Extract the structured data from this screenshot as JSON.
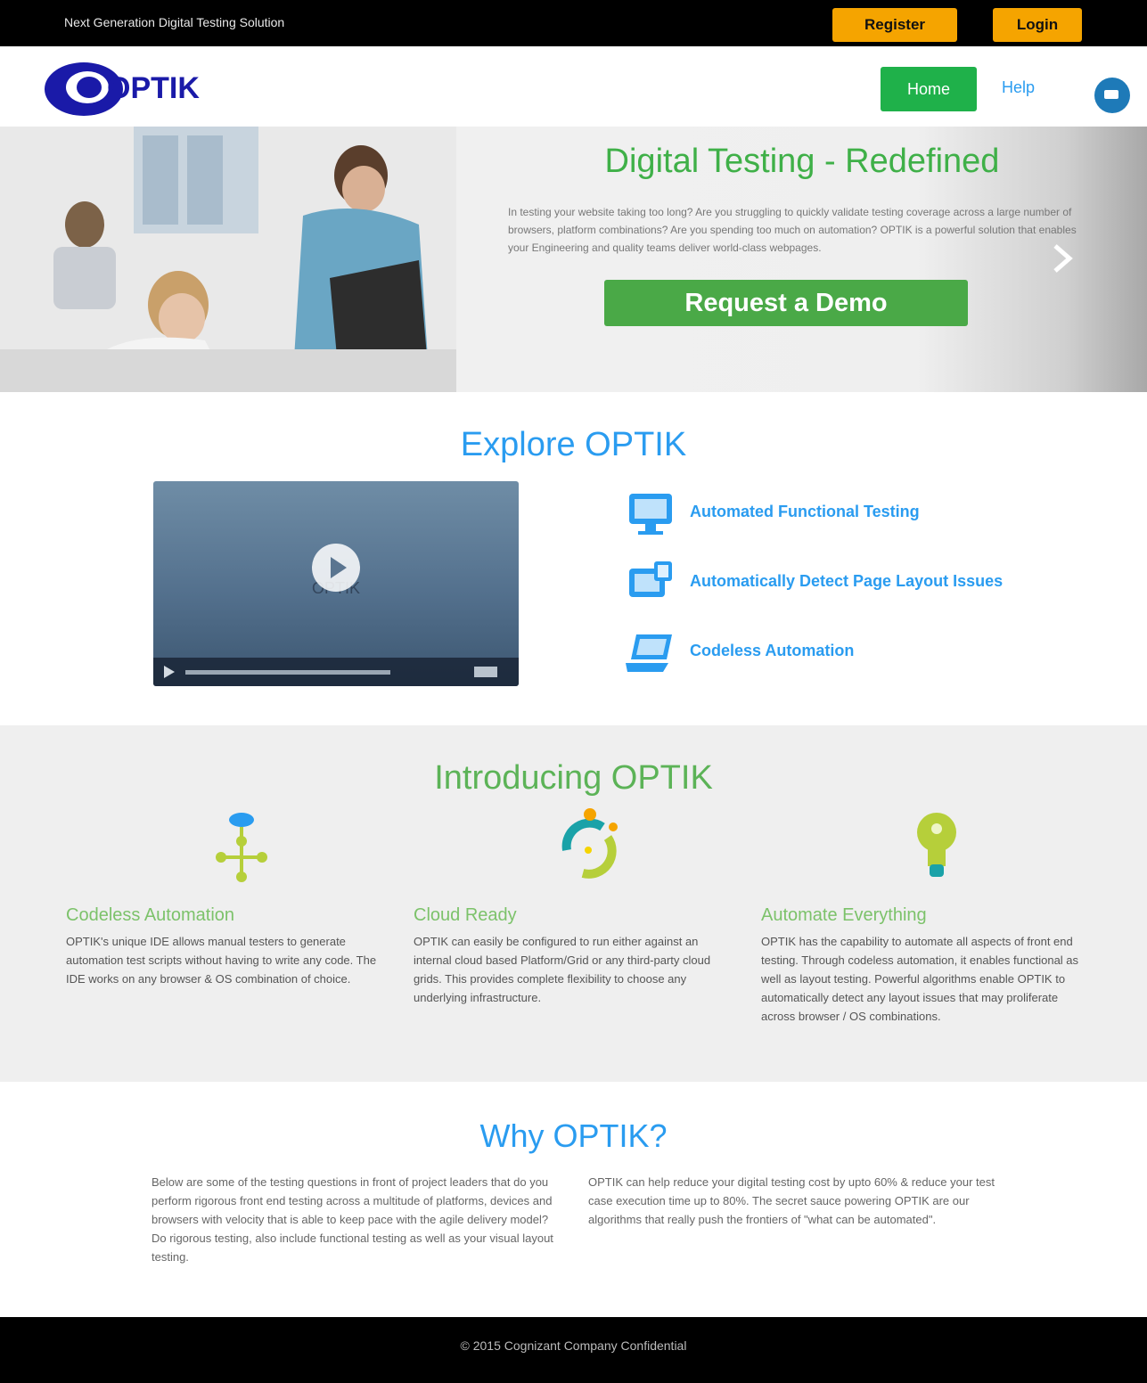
{
  "topbar": {
    "tagline": "Next Generation Digital Testing Solution",
    "register_label": "Register",
    "login_label": "Login"
  },
  "header": {
    "logo_text": "OPTIK",
    "home_label": "Home",
    "help_label": "Help"
  },
  "hero": {
    "title": "Digital Testing - Redefined",
    "description": "In testing your website taking too long? Are you struggling to quickly validate testing coverage across a large number of browsers, platform combinations? Are you spending too much on automation? OPTIK is a powerful solution that enables your Engineering and quality teams deliver world-class webpages.",
    "demo_label": "Request a Demo"
  },
  "explore": {
    "title": "Explore OPTIK",
    "video_caption": "OPTIK",
    "features": [
      {
        "label": "Automated Functional Testing",
        "icon": "monitor-icon"
      },
      {
        "label": "Automatically Detect Page Layout Issues",
        "icon": "layout-icon"
      },
      {
        "label": "Codeless Automation",
        "icon": "laptop-icon"
      }
    ]
  },
  "introducing": {
    "title": "Introducing OPTIK",
    "columns": [
      {
        "title": "Codeless Automation",
        "text": "OPTIK's unique IDE allows manual testers to generate automation test scripts without having to write any code. The IDE works on any browser & OS combination of choice.",
        "icon": "network-icon"
      },
      {
        "title": "Cloud Ready",
        "text": "OPTIK can easily be configured to run either against an internal cloud based Platform/Grid or any third-party cloud grids. This provides complete flexibility to choose any underlying infrastructure.",
        "icon": "cloud-cycle-icon"
      },
      {
        "title": "Automate Everything",
        "text": "OPTIK has the capability to automate all aspects of front end testing. Through codeless automation, it enables functional as well as layout testing. Powerful algorithms enable OPTIK to automatically detect any layout issues that may proliferate across browser / OS combinations.",
        "icon": "lightbulb-icon"
      }
    ]
  },
  "why": {
    "title": "Why OPTIK?",
    "left": "Below are some of the testing questions in front of project leaders that do you perform rigorous front end testing across a multitude of platforms, devices and browsers with velocity that is able to keep pace with the agile delivery model? Do rigorous testing, also include functional testing as well as your visual layout testing.",
    "right": "OPTIK can help reduce your digital testing cost by upto 60% & reduce your test case execution time up to 80%. The secret sauce powering OPTIK are our algorithms that really push the frontiers of \"what can be automated\"."
  },
  "footer": {
    "copyright": "© 2015 Cognizant Company Confidential"
  },
  "colors": {
    "accent_green": "#4aa947",
    "accent_blue": "#2a9cf0",
    "accent_amber": "#f5a400"
  }
}
